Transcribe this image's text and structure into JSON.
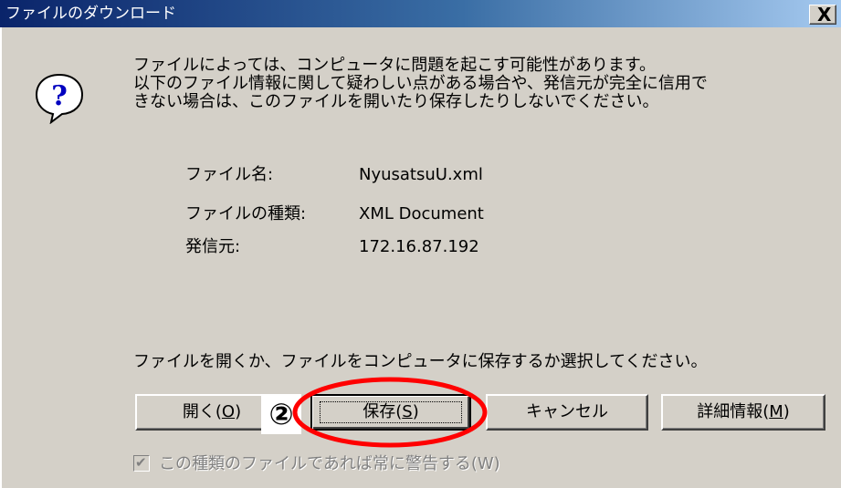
{
  "dialog": {
    "title": "ファイルのダウンロード",
    "close_label": "X"
  },
  "warning": {
    "icon": "question-icon",
    "lines": [
      "ファイルによっては、コンピュータに問題を起こす可能性があります。",
      "以下のファイル情報に関して疑わしい点がある場合や、発信元が完全に信用で",
      "きない場合は、このファイルを開いたり保存したりしないでください。"
    ]
  },
  "file_info": {
    "name_label": "ファイル名:",
    "name_value": "NyusatsuU.xml",
    "type_label": "ファイルの種類:",
    "type_value": "XML Document",
    "source_label": "発信元:",
    "source_value": "172.16.87.192"
  },
  "prompt": "ファイルを開くか、ファイルをコンピュータに保存するか選択してください。",
  "buttons": {
    "open": {
      "text": "開く(",
      "key": "O",
      "close": ")"
    },
    "save": {
      "text": "保存(",
      "key": "S",
      "close": ")"
    },
    "cancel": {
      "text": "キャンセル"
    },
    "details": {
      "text": "詳細情報(",
      "key": "M",
      "close": ")"
    }
  },
  "annotation": {
    "step_marker": "②",
    "highlight_color": "#ff0000"
  },
  "checkbox": {
    "checked": true,
    "disabled": true,
    "label": "この種類のファイルであれば常に警告する(W)"
  },
  "colors": {
    "title_start": "#0a246a",
    "title_end": "#a6caf0",
    "face": "#d4d0c8"
  }
}
